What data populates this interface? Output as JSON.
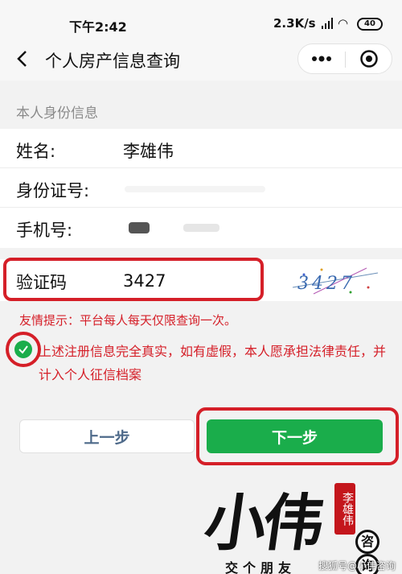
{
  "status_bar": {
    "time": "下午2:42",
    "network_speed": "2.3K/s",
    "battery": "40"
  },
  "nav": {
    "title": "个人房产信息查询",
    "back_icon": "chevron-left-icon",
    "more_icon": "more-dots-icon",
    "close_icon": "target-close-icon"
  },
  "section": {
    "label": "本人身份信息"
  },
  "form": {
    "name_label": "姓名:",
    "name_value": "李雄伟",
    "id_label": "身份证号:",
    "phone_label": "手机号:"
  },
  "captcha": {
    "label": "验证码",
    "value": "3427",
    "image_text": "3427"
  },
  "tip": "友情提示：平台每人每天仅限查询一次。",
  "agreement": {
    "text": "上述注册信息完全真实，如有虚假，本人愿承担法律责任，并计入个人征信档案",
    "checked": true
  },
  "buttons": {
    "prev": "上一步",
    "next": "下一步"
  },
  "watermark": {
    "big_text": "小伟",
    "seal": "李雄伟",
    "consult_1": "咨",
    "consult_2": "询",
    "slogan": "交个朋友",
    "source": "搜狐号@小伟咨询"
  },
  "colors": {
    "accent_green": "#1aad4b",
    "highlight_red": "#d51f28",
    "prev_text": "#4e6a8a"
  }
}
